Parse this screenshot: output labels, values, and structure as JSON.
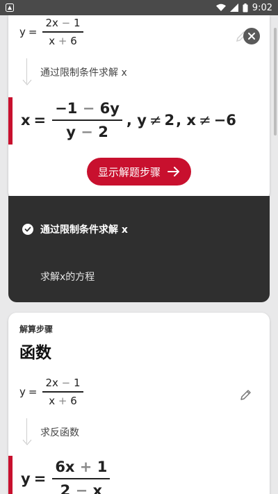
{
  "status_bar": {
    "time": "9:02",
    "icons": [
      "app-notification-icon",
      "wifi-icon",
      "signal-icon",
      "battery-icon"
    ]
  },
  "top_card": {
    "equation": {
      "lhs": "y",
      "eq": "=",
      "num_a": "2x",
      "num_op": "−",
      "num_b": "1",
      "den_a": "x",
      "den_op": "+",
      "den_b": "6"
    },
    "step_text": "通过限制条件求解 x",
    "result": {
      "lhs": "x",
      "eq": "=",
      "num_a": "−1",
      "num_op": "−",
      "num_b": "6y",
      "den_a": "y",
      "den_op": "−",
      "den_b": "2",
      "cond1_var": ", y",
      "cond1_op": "≠",
      "cond1_val": "2",
      "cond2_var": ", x",
      "cond2_op": "≠",
      "cond2_val": "−6"
    },
    "show_steps_label": "显示解题步骤"
  },
  "dark_panel": {
    "step_title": "通过限制条件求解 x",
    "sub_step": "求解x的方程"
  },
  "bottom_card": {
    "section_label": "解算步骤",
    "section_title": "函数",
    "equation": {
      "lhs": "y",
      "eq": "=",
      "num_a": "2x",
      "num_op": "−",
      "num_b": "1",
      "den_a": "x",
      "den_op": "+",
      "den_b": "6"
    },
    "step_text": "求反函数",
    "result": {
      "lhs": "y",
      "eq": "=",
      "num_a": "6x",
      "num_op": "+",
      "num_b": "1",
      "den_a": "2",
      "den_op": "−",
      "den_b": "x"
    }
  },
  "colors": {
    "accent": "#c8102e",
    "dark_panel": "#2f2f2f",
    "background": "#e9e9ea"
  }
}
